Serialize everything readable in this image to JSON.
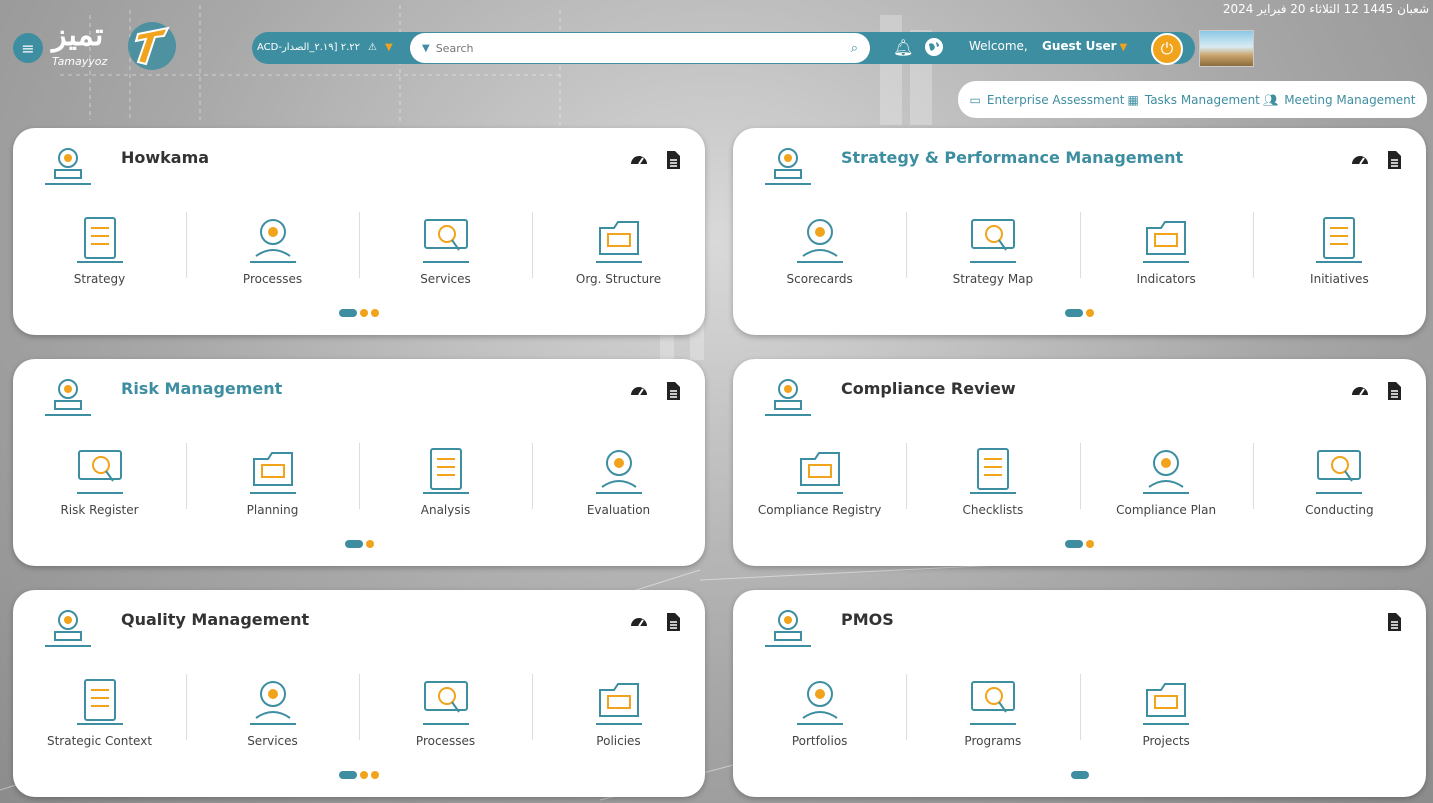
{
  "header": {
    "date_text": "شعبان 1445 12     الثلاثاء 20 فبراير 2024",
    "logo_arabic": "تميز",
    "logo_english": "Tamayyoz",
    "version_label": "ACD-٢.٢٢ [٢.١٩_الصدار",
    "search_placeholder": "Search",
    "welcome_label": "Welcome,",
    "user_name": "Guest User",
    "colors": {
      "primary": "#3e8ea1",
      "accent": "#f0a31b"
    }
  },
  "quicklinks": [
    {
      "label": "Enterprise Assessment",
      "icon": "assessment-icon"
    },
    {
      "label": "Tasks Management",
      "icon": "calendar-icon"
    },
    {
      "label": "Meeting Management",
      "icon": "users-icon"
    }
  ],
  "cards": [
    {
      "title": "Howkama",
      "accent": false,
      "icon": "building-icon",
      "items": [
        "Strategy",
        "Processes",
        "Services",
        "Org. Structure"
      ],
      "dots": "pill-dot-dot"
    },
    {
      "title": "Strategy & Performance Management",
      "accent": true,
      "icon": "target-icon",
      "items": [
        "Scorecards",
        "Strategy Map",
        "Indicators",
        "Initiatives"
      ],
      "dots": "pill-dot"
    },
    {
      "title": "Risk Management",
      "accent": true,
      "icon": "crossed-swords-icon",
      "items": [
        "Risk Register",
        "Planning",
        "Analysis",
        "Evaluation"
      ],
      "dots": "pill-dot"
    },
    {
      "title": "Compliance Review",
      "accent": false,
      "icon": "clipboard-check-icon",
      "items": [
        "Compliance Registry",
        "Checklists",
        "Compliance Plan",
        "Conducting"
      ],
      "dots": "pill-dot"
    },
    {
      "title": "Quality Management",
      "accent": false,
      "icon": "quality-medal-icon",
      "items": [
        "Strategic Context",
        "Services",
        "Processes",
        "Policies"
      ],
      "dots": "pill-dot-dot"
    },
    {
      "title": "PMOS",
      "accent": false,
      "icon": "blueprint-icon",
      "items": [
        "Portfolios",
        "Programs",
        "Projects"
      ],
      "dots": "pill"
    }
  ]
}
